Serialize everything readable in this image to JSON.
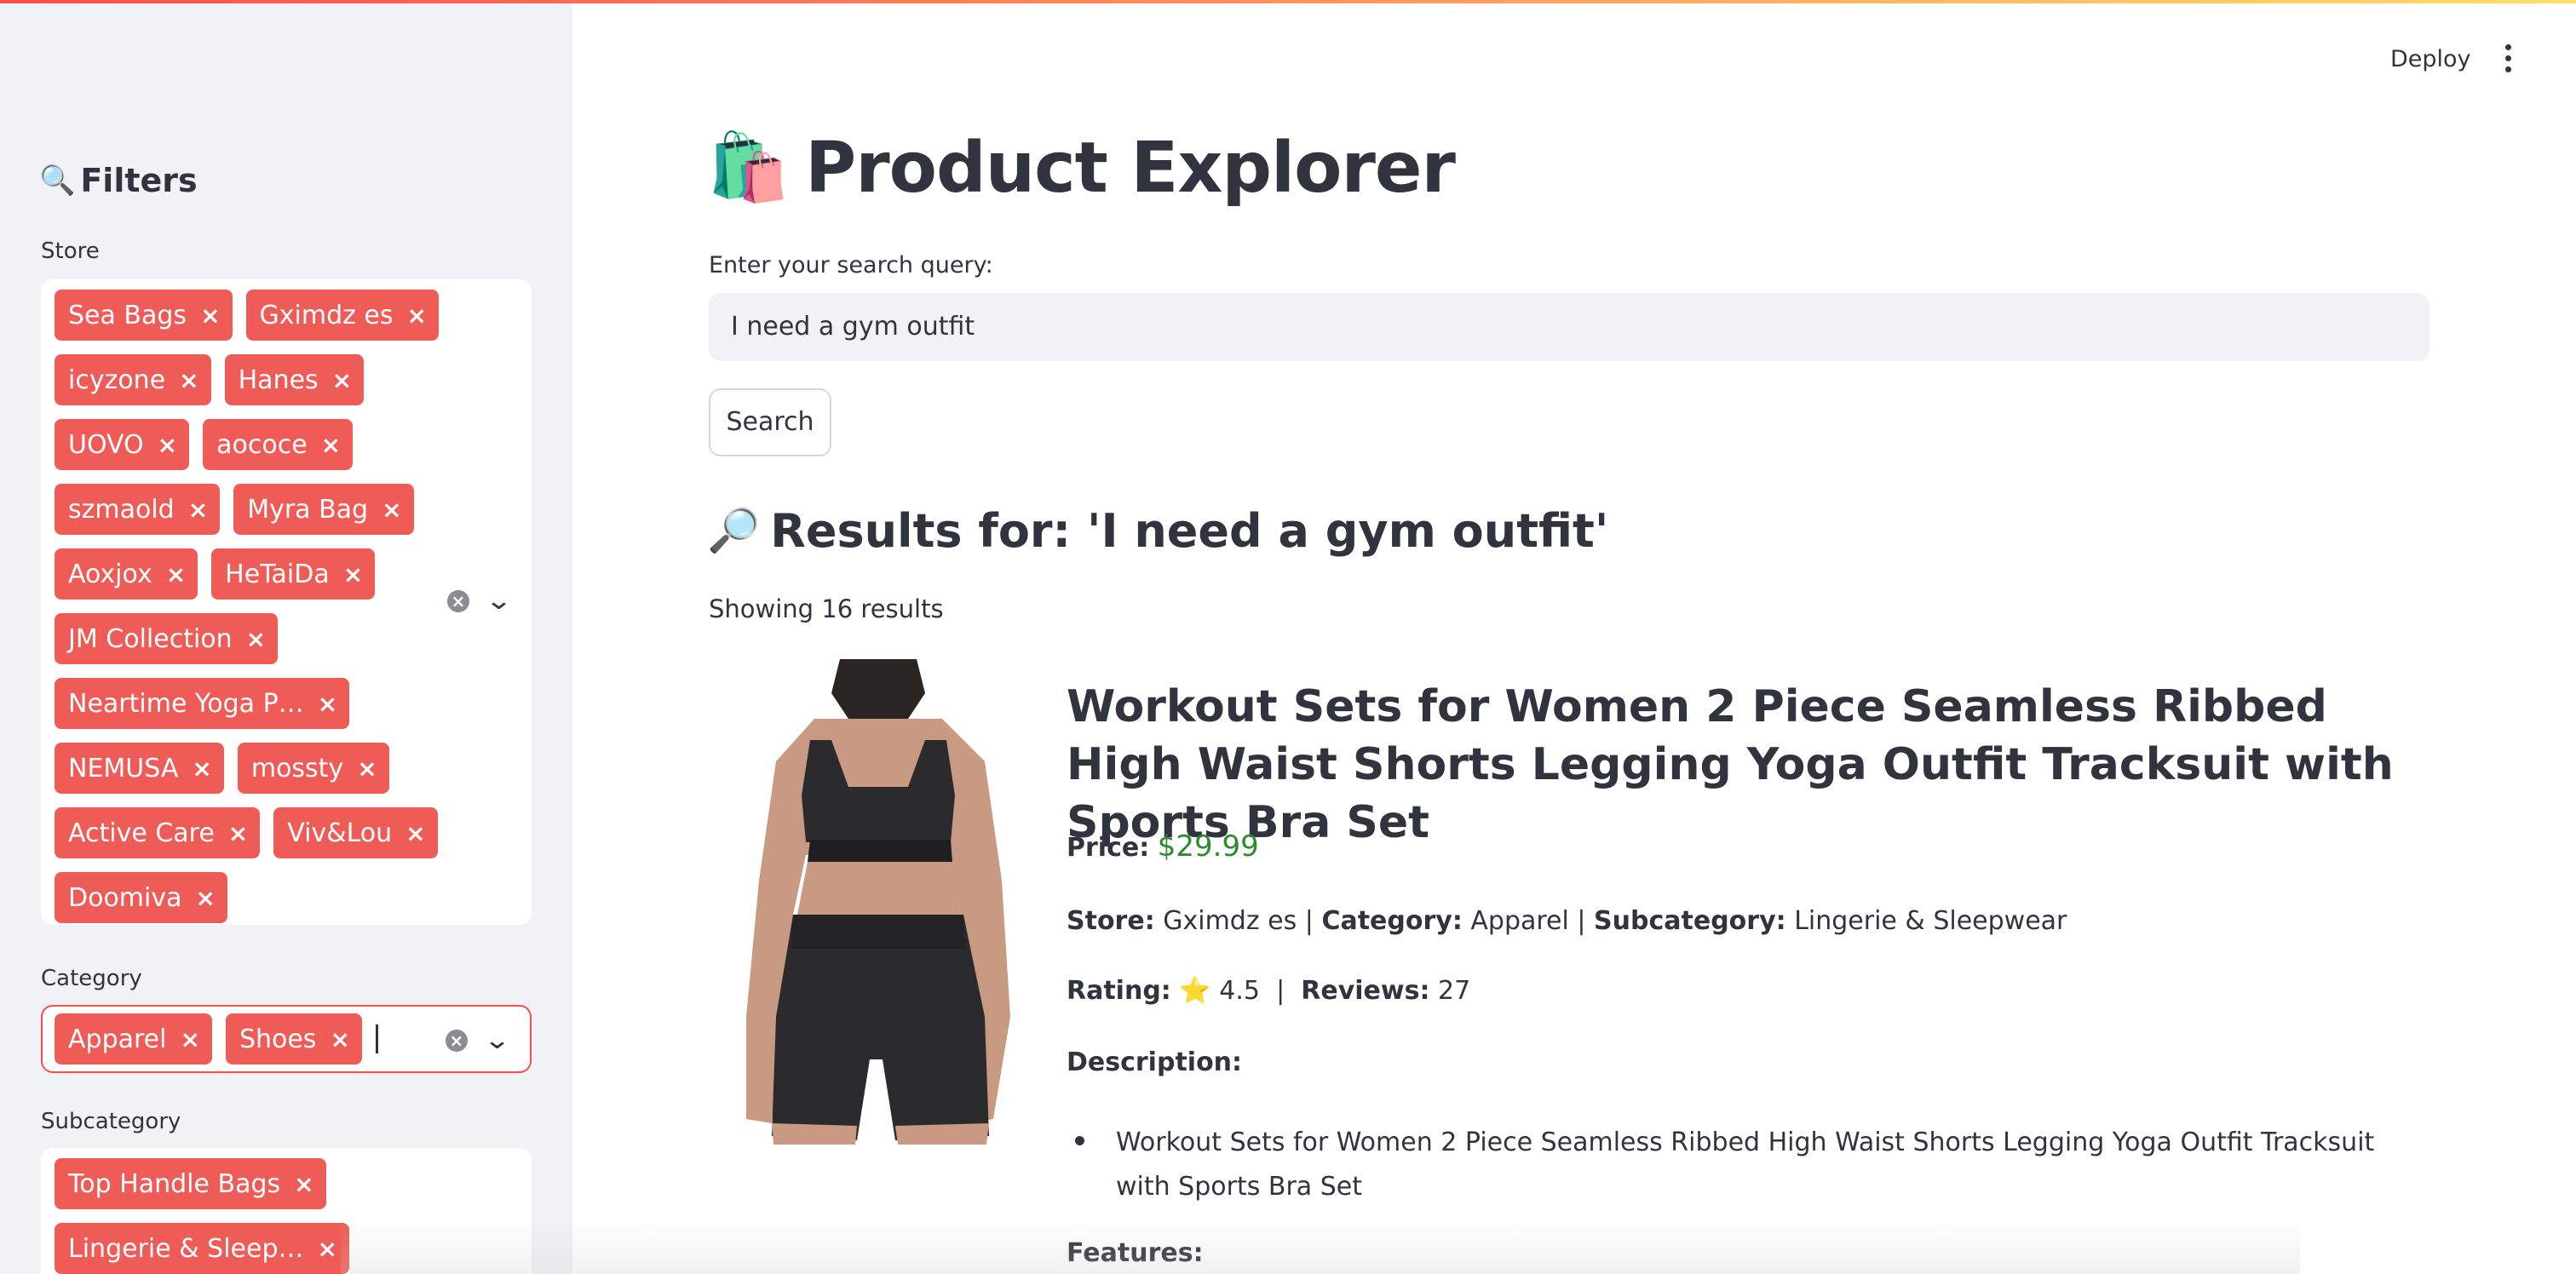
{
  "sidebar": {
    "filters_title": "Filters",
    "filters_icon": "magnifier-icon",
    "store": {
      "label": "Store",
      "tags": [
        "Sea Bags",
        "Gximdz es",
        "icyzone",
        "Hanes",
        "UOVO",
        "aococe",
        "szmaold",
        "Myra Bag",
        "Aoxjox",
        "HeTaiDa",
        "JM Collection",
        "Neartime Yoga P…",
        "NEMUSA",
        "mossty",
        "Active Care",
        "Viv&Lou",
        "Doomiva"
      ]
    },
    "category": {
      "label": "Category",
      "tags": [
        "Apparel",
        "Shoes"
      ]
    },
    "subcategory": {
      "label": "Subcategory",
      "tags": [
        "Top Handle Bags",
        "Lingerie & Sleep…"
      ]
    },
    "tag_remove_glyph": "×",
    "clear_glyph": "×",
    "chevron_glyph": "⌄"
  },
  "header": {
    "deploy_label": "Deploy",
    "menu_icon": "kebab-menu-icon"
  },
  "main": {
    "title_emoji": "🛍️",
    "title": "Product Explorer",
    "search_label": "Enter your search query:",
    "search_value": "I need a gym outfit",
    "search_button": "Search",
    "results_emoji": "🔎",
    "results_heading": "Results for: 'I need a gym outfit'",
    "results_count": "Showing 16 results"
  },
  "product": {
    "title": "Workout Sets for Women 2 Piece Seamless Ribbed High Waist Shorts Legging Yoga Outfit Tracksuit with Sports Bra Set",
    "price_label": "Price:",
    "price": "$29.99",
    "store_label": "Store:",
    "store": "Gximdz es",
    "category_label": "Category:",
    "category": "Apparel",
    "subcategory_label": "Subcategory:",
    "subcategory": "Lingerie & Sleepwear",
    "separator": "|",
    "rating_label": "Rating:",
    "rating_star": "⭐",
    "rating": "4.5",
    "reviews_label": "Reviews:",
    "reviews": "27",
    "description_label": "Description:",
    "description_items": [
      "Workout Sets for Women 2 Piece Seamless Ribbed High Waist Shorts Legging Yoga Outfit Tracksuit with Sports Bra Set"
    ],
    "features_label": "Features:"
  },
  "colors": {
    "accent": "#ff4b4b",
    "tag": "#ef5b56",
    "sidebar_bg": "#f0f2f6",
    "price_green": "#2f8a2f",
    "text": "#31333f"
  }
}
